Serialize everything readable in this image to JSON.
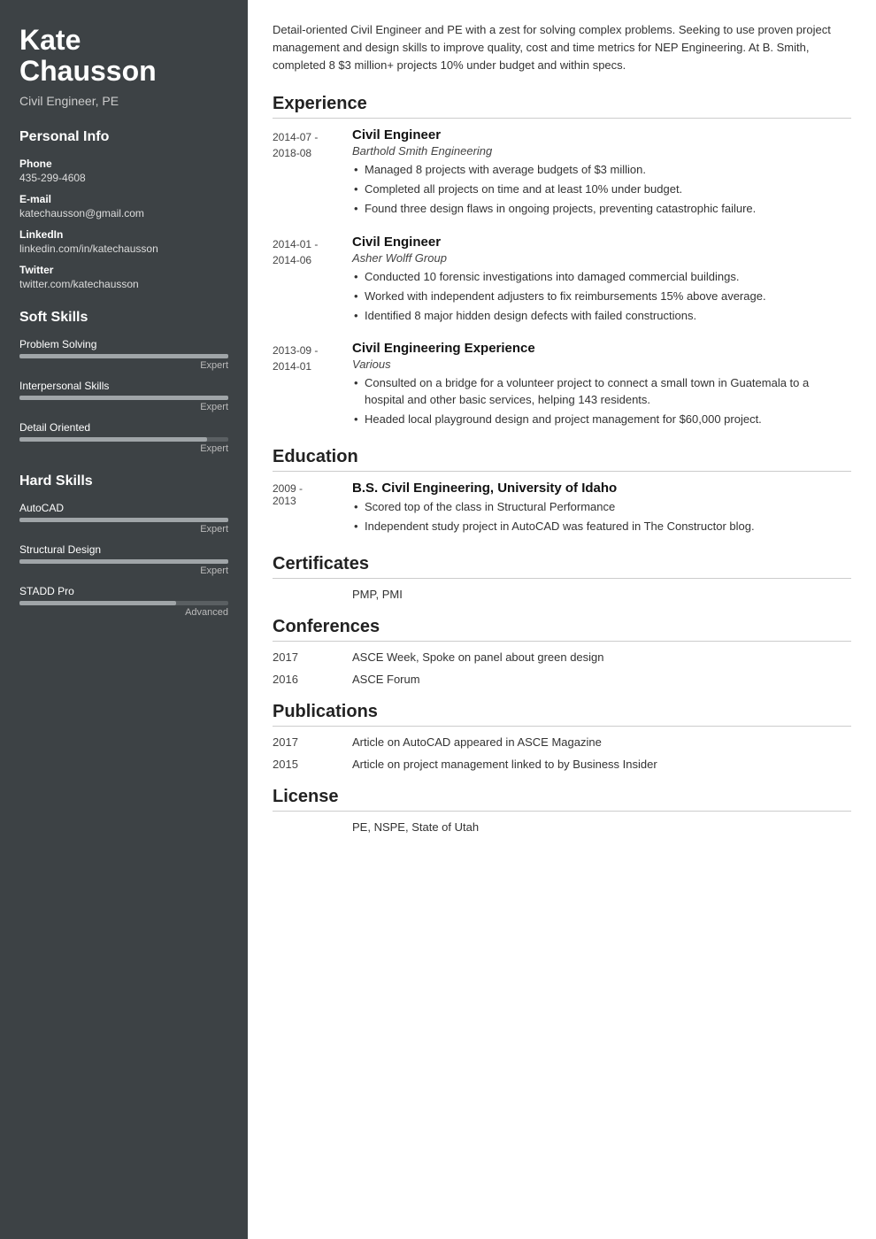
{
  "sidebar": {
    "name": "Kate\nChausson",
    "title": "Civil Engineer, PE",
    "personal_info_label": "Personal Info",
    "phone_label": "Phone",
    "phone": "435-299-4608",
    "email_label": "E-mail",
    "email": "katechausson@gmail.com",
    "linkedin_label": "LinkedIn",
    "linkedin": "linkedin.com/in/katechausson",
    "twitter_label": "Twitter",
    "twitter": "twitter.com/katechausson",
    "soft_skills_label": "Soft Skills",
    "soft_skills": [
      {
        "name": "Problem Solving",
        "level": "Expert",
        "pct": 100
      },
      {
        "name": "Interpersonal Skills",
        "level": "Expert",
        "pct": 100
      },
      {
        "name": "Detail Oriented",
        "level": "Expert",
        "pct": 90
      }
    ],
    "hard_skills_label": "Hard Skills",
    "hard_skills": [
      {
        "name": "AutoCAD",
        "level": "Expert",
        "pct": 100
      },
      {
        "name": "Structural Design",
        "level": "Expert",
        "pct": 100
      },
      {
        "name": "STADD Pro",
        "level": "Advanced",
        "pct": 75
      }
    ]
  },
  "main": {
    "summary": "Detail-oriented Civil Engineer and PE with a zest for solving complex problems. Seeking to use proven project management and design skills to improve quality, cost and time metrics for NEP Engineering. At B. Smith, completed 8 $3 million+ projects 10% under budget and within specs.",
    "experience_label": "Experience",
    "experiences": [
      {
        "date": "2014-07 -\n2018-08",
        "title": "Civil Engineer",
        "company": "Barthold Smith Engineering",
        "bullets": [
          "Managed 8 projects with average budgets of $3 million.",
          "Completed all projects on time and at least 10% under budget.",
          "Found three design flaws in ongoing projects, preventing catastrophic failure."
        ]
      },
      {
        "date": "2014-01 -\n2014-06",
        "title": "Civil Engineer",
        "company": "Asher Wolff Group",
        "bullets": [
          "Conducted 10 forensic investigations into damaged commercial buildings.",
          "Worked with independent adjusters to fix reimbursements 15% above average.",
          "Identified 8 major hidden design defects with failed constructions."
        ]
      },
      {
        "date": "2013-09 -\n2014-01",
        "title": "Civil Engineering Experience",
        "company": "Various",
        "bullets": [
          "Consulted on a bridge for a volunteer project to connect a small town in Guatemala to a hospital and other basic services, helping 143 residents.",
          "Headed local playground design and project management for $60,000 project."
        ]
      }
    ],
    "education_label": "Education",
    "education": [
      {
        "date": "2009 -\n2013",
        "degree": "B.S. Civil Engineering, University of Idaho",
        "bullets": [
          "Scored top of the class in Structural Performance",
          "Independent study project in AutoCAD was featured in The Constructor blog."
        ]
      }
    ],
    "certificates_label": "Certificates",
    "certificates": [
      {
        "date": "",
        "value": "PMP, PMI"
      }
    ],
    "conferences_label": "Conferences",
    "conferences": [
      {
        "date": "2017",
        "value": "ASCE Week, Spoke on panel about green design"
      },
      {
        "date": "2016",
        "value": "ASCE Forum"
      }
    ],
    "publications_label": "Publications",
    "publications": [
      {
        "date": "2017",
        "value": "Article on AutoCAD appeared in ASCE Magazine"
      },
      {
        "date": "2015",
        "value": "Article on project management linked to by Business Insider"
      }
    ],
    "license_label": "License",
    "licenses": [
      {
        "date": "",
        "value": "PE, NSPE, State of Utah"
      }
    ]
  }
}
